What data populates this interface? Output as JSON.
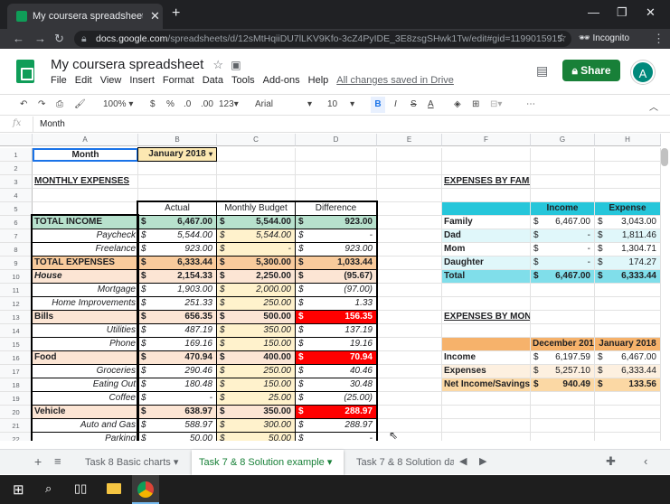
{
  "browser": {
    "tab_title": "My coursera spreadsheet - Goog",
    "url_domain": "docs.google.com",
    "url_path": "/spreadsheets/d/12sMtHqiiDU7lLKV9Kfo-3cZ4PyIDE_3E8zsgSHwk1Tw/edit#gid=1199015915",
    "incognito_label": "Incognito"
  },
  "doc": {
    "title": "My coursera spreadsheet",
    "menu": [
      "File",
      "Edit",
      "View",
      "Insert",
      "Format",
      "Data",
      "Tools",
      "Add-ons",
      "Help"
    ],
    "saved": "All changes saved in Drive",
    "share": "Share",
    "avatar": "A"
  },
  "toolbar": {
    "zoom": "100%",
    "currency": "$",
    "percent": "%",
    "dec_less": ".0",
    "dec_more": ".00",
    "fmt": "123",
    "font": "Arial",
    "size": "10",
    "bold": "B",
    "italic": "I",
    "strike": "S",
    "textcolor": "A"
  },
  "formula_bar": {
    "fx": "fx",
    "content": "Month"
  },
  "columns": [
    "A",
    "B",
    "C",
    "D",
    "E",
    "F",
    "G",
    "H"
  ],
  "rows": [
    "1",
    "2",
    "3",
    "4",
    "5",
    "6",
    "7",
    "8",
    "9",
    "10",
    "11",
    "12",
    "13",
    "14",
    "15",
    "16",
    "17",
    "18",
    "19",
    "20",
    "21",
    "22"
  ],
  "cells": [
    {
      "k": "A1",
      "r": 1,
      "c": "A",
      "t": "Month",
      "al": "c",
      "b": 1,
      "bd": "#1a73e8"
    },
    {
      "k": "B1",
      "r": 1,
      "c": "B",
      "t": "January 2018",
      "al": "c",
      "b": 1,
      "bg": "#fce8b2",
      "dd": 1
    },
    {
      "k": "A3",
      "r": 3,
      "c": "A",
      "t": "MONTHLY EXPENSES",
      "b": 1,
      "u": 1
    },
    {
      "k": "B5",
      "r": 5,
      "c": "B",
      "t": "Actual",
      "al": "c"
    },
    {
      "k": "C5",
      "r": 5,
      "c": "C",
      "t": "Monthly Budget",
      "al": "c"
    },
    {
      "k": "D5",
      "r": 5,
      "c": "D",
      "t": "Difference",
      "al": "c"
    },
    {
      "k": "A6",
      "r": 6,
      "c": "A",
      "t": "TOTAL INCOME",
      "b": 1,
      "bg": "#b7e1cd"
    },
    {
      "k": "B6",
      "r": 6,
      "c": "B",
      "t": "6,467.00",
      "b": 1,
      "bg": "#b7e1cd",
      "cur": 1
    },
    {
      "k": "C6",
      "r": 6,
      "c": "C",
      "t": "5,544.00",
      "b": 1,
      "bg": "#b7e1cd",
      "cur": 1
    },
    {
      "k": "D6",
      "r": 6,
      "c": "D",
      "t": "923.00",
      "b": 1,
      "bg": "#b7e1cd",
      "cur": 1
    },
    {
      "k": "A7",
      "r": 7,
      "c": "A",
      "t": "Paycheck",
      "i": 1,
      "al": "r"
    },
    {
      "k": "B7",
      "r": 7,
      "c": "B",
      "t": "5,544.00",
      "i": 1,
      "cur": 1
    },
    {
      "k": "C7",
      "r": 7,
      "c": "C",
      "t": "5,544.00",
      "i": 1,
      "bg": "#fff2cc",
      "cur": 1
    },
    {
      "k": "D7",
      "r": 7,
      "c": "D",
      "t": "-",
      "i": 1,
      "cur": 1
    },
    {
      "k": "A8",
      "r": 8,
      "c": "A",
      "t": "Freelance",
      "i": 1,
      "al": "r"
    },
    {
      "k": "B8",
      "r": 8,
      "c": "B",
      "t": "923.00",
      "i": 1,
      "cur": 1
    },
    {
      "k": "C8",
      "r": 8,
      "c": "C",
      "t": "-",
      "i": 1,
      "bg": "#fff2cc",
      "cur": 1
    },
    {
      "k": "D8",
      "r": 8,
      "c": "D",
      "t": "923.00",
      "i": 1,
      "cur": 1
    },
    {
      "k": "A9",
      "r": 9,
      "c": "A",
      "t": "TOTAL EXPENSES",
      "b": 1,
      "bg": "#f9cb9c"
    },
    {
      "k": "B9",
      "r": 9,
      "c": "B",
      "t": "6,333.44",
      "b": 1,
      "bg": "#f9cb9c",
      "cur": 1
    },
    {
      "k": "C9",
      "r": 9,
      "c": "C",
      "t": "5,300.00",
      "b": 1,
      "bg": "#f9cb9c",
      "cur": 1
    },
    {
      "k": "D9",
      "r": 9,
      "c": "D",
      "t": "1,033.44",
      "b": 1,
      "bg": "#f9cb9c",
      "cur": 1
    },
    {
      "k": "A10",
      "r": 10,
      "c": "A",
      "t": "House",
      "b": 1,
      "i": 1,
      "bg": "#fce5d4"
    },
    {
      "k": "B10",
      "r": 10,
      "c": "B",
      "t": "2,154.33",
      "b": 1,
      "bg": "#fce5d4",
      "cur": 1
    },
    {
      "k": "C10",
      "r": 10,
      "c": "C",
      "t": "2,250.00",
      "b": 1,
      "bg": "#fce5d4",
      "cur": 1
    },
    {
      "k": "D10",
      "r": 10,
      "c": "D",
      "t": "(95.67)",
      "b": 1,
      "bg": "#fce5d4",
      "cur": 1
    },
    {
      "k": "A11",
      "r": 11,
      "c": "A",
      "t": "Mortgage",
      "i": 1,
      "al": "r"
    },
    {
      "k": "B11",
      "r": 11,
      "c": "B",
      "t": "1,903.00",
      "i": 1,
      "cur": 1
    },
    {
      "k": "C11",
      "r": 11,
      "c": "C",
      "t": "2,000.00",
      "i": 1,
      "bg": "#fff2cc",
      "cur": 1
    },
    {
      "k": "D11",
      "r": 11,
      "c": "D",
      "t": "(97.00)",
      "i": 1,
      "cur": 1
    },
    {
      "k": "A12",
      "r": 12,
      "c": "A",
      "t": "Home Improvements",
      "i": 1,
      "al": "r"
    },
    {
      "k": "B12",
      "r": 12,
      "c": "B",
      "t": "251.33",
      "i": 1,
      "cur": 1
    },
    {
      "k": "C12",
      "r": 12,
      "c": "C",
      "t": "250.00",
      "i": 1,
      "bg": "#fff2cc",
      "cur": 1
    },
    {
      "k": "D12",
      "r": 12,
      "c": "D",
      "t": "1.33",
      "i": 1,
      "cur": 1
    },
    {
      "k": "A13",
      "r": 13,
      "c": "A",
      "t": "Bills",
      "b": 1,
      "bg": "#fce5d4"
    },
    {
      "k": "B13",
      "r": 13,
      "c": "B",
      "t": "656.35",
      "b": 1,
      "bg": "#fce5d4",
      "cur": 1
    },
    {
      "k": "C13",
      "r": 13,
      "c": "C",
      "t": "500.00",
      "b": 1,
      "bg": "#fce5d4",
      "cur": 1
    },
    {
      "k": "D13",
      "r": 13,
      "c": "D",
      "t": "156.35",
      "b": 1,
      "bg": "#ff0000",
      "fg": "#fff",
      "cur": 1
    },
    {
      "k": "A14",
      "r": 14,
      "c": "A",
      "t": "Utilities",
      "i": 1,
      "al": "r"
    },
    {
      "k": "B14",
      "r": 14,
      "c": "B",
      "t": "487.19",
      "i": 1,
      "cur": 1
    },
    {
      "k": "C14",
      "r": 14,
      "c": "C",
      "t": "350.00",
      "i": 1,
      "bg": "#fff2cc",
      "cur": 1
    },
    {
      "k": "D14",
      "r": 14,
      "c": "D",
      "t": "137.19",
      "i": 1,
      "cur": 1
    },
    {
      "k": "A15",
      "r": 15,
      "c": "A",
      "t": "Phone",
      "i": 1,
      "al": "r"
    },
    {
      "k": "B15",
      "r": 15,
      "c": "B",
      "t": "169.16",
      "i": 1,
      "cur": 1
    },
    {
      "k": "C15",
      "r": 15,
      "c": "C",
      "t": "150.00",
      "i": 1,
      "bg": "#fff2cc",
      "cur": 1
    },
    {
      "k": "D15",
      "r": 15,
      "c": "D",
      "t": "19.16",
      "i": 1,
      "cur": 1
    },
    {
      "k": "A16",
      "r": 16,
      "c": "A",
      "t": "Food",
      "b": 1,
      "bg": "#fce5d4"
    },
    {
      "k": "B16",
      "r": 16,
      "c": "B",
      "t": "470.94",
      "b": 1,
      "bg": "#fce5d4",
      "cur": 1
    },
    {
      "k": "C16",
      "r": 16,
      "c": "C",
      "t": "400.00",
      "b": 1,
      "bg": "#fce5d4",
      "cur": 1
    },
    {
      "k": "D16",
      "r": 16,
      "c": "D",
      "t": "70.94",
      "b": 1,
      "bg": "#ff0000",
      "fg": "#fff",
      "cur": 1
    },
    {
      "k": "A17",
      "r": 17,
      "c": "A",
      "t": "Groceries",
      "i": 1,
      "al": "r"
    },
    {
      "k": "B17",
      "r": 17,
      "c": "B",
      "t": "290.46",
      "i": 1,
      "cur": 1
    },
    {
      "k": "C17",
      "r": 17,
      "c": "C",
      "t": "250.00",
      "i": 1,
      "bg": "#fff2cc",
      "cur": 1
    },
    {
      "k": "D17",
      "r": 17,
      "c": "D",
      "t": "40.46",
      "i": 1,
      "cur": 1
    },
    {
      "k": "A18",
      "r": 18,
      "c": "A",
      "t": "Eating Out",
      "i": 1,
      "al": "r"
    },
    {
      "k": "B18",
      "r": 18,
      "c": "B",
      "t": "180.48",
      "i": 1,
      "cur": 1
    },
    {
      "k": "C18",
      "r": 18,
      "c": "C",
      "t": "150.00",
      "i": 1,
      "bg": "#fff2cc",
      "cur": 1
    },
    {
      "k": "D18",
      "r": 18,
      "c": "D",
      "t": "30.48",
      "i": 1,
      "cur": 1
    },
    {
      "k": "A19",
      "r": 19,
      "c": "A",
      "t": "Coffee",
      "i": 1,
      "al": "r"
    },
    {
      "k": "B19",
      "r": 19,
      "c": "B",
      "t": "-",
      "i": 1,
      "cur": 1
    },
    {
      "k": "C19",
      "r": 19,
      "c": "C",
      "t": "25.00",
      "i": 1,
      "bg": "#fff2cc",
      "cur": 1
    },
    {
      "k": "D19",
      "r": 19,
      "c": "D",
      "t": "(25.00)",
      "i": 1,
      "cur": 1
    },
    {
      "k": "A20",
      "r": 20,
      "c": "A",
      "t": "Vehicle",
      "b": 1,
      "bg": "#fce5d4"
    },
    {
      "k": "B20",
      "r": 20,
      "c": "B",
      "t": "638.97",
      "b": 1,
      "bg": "#fce5d4",
      "cur": 1
    },
    {
      "k": "C20",
      "r": 20,
      "c": "C",
      "t": "350.00",
      "b": 1,
      "bg": "#fce5d4",
      "cur": 1
    },
    {
      "k": "D20",
      "r": 20,
      "c": "D",
      "t": "288.97",
      "b": 1,
      "bg": "#ff0000",
      "fg": "#fff",
      "cur": 1
    },
    {
      "k": "A21",
      "r": 21,
      "c": "A",
      "t": "Auto and Gas",
      "i": 1,
      "al": "r"
    },
    {
      "k": "B21",
      "r": 21,
      "c": "B",
      "t": "588.97",
      "i": 1,
      "cur": 1
    },
    {
      "k": "C21",
      "r": 21,
      "c": "C",
      "t": "300.00",
      "i": 1,
      "bg": "#fff2cc",
      "cur": 1
    },
    {
      "k": "D21",
      "r": 21,
      "c": "D",
      "t": "288.97",
      "i": 1,
      "cur": 1
    },
    {
      "k": "A22",
      "r": 22,
      "c": "A",
      "t": "Parking",
      "i": 1,
      "al": "r"
    },
    {
      "k": "B22",
      "r": 22,
      "c": "B",
      "t": "50.00",
      "i": 1,
      "cur": 1
    },
    {
      "k": "C22",
      "r": 22,
      "c": "C",
      "t": "50.00",
      "i": 1,
      "bg": "#fff2cc",
      "cur": 1
    },
    {
      "k": "D22",
      "r": 22,
      "c": "D",
      "t": "-",
      "i": 1,
      "cur": 1
    },
    {
      "k": "F3",
      "r": 3,
      "c": "F",
      "t": "EXPENSES BY FAMILY MEMBER",
      "b": 1,
      "u": 1
    },
    {
      "k": "F5",
      "r": 5,
      "c": "F",
      "t": "",
      "bg": "#26c6da"
    },
    {
      "k": "G5",
      "r": 5,
      "c": "G",
      "t": "Income",
      "b": 1,
      "al": "c",
      "bg": "#26c6da"
    },
    {
      "k": "H5",
      "r": 5,
      "c": "H",
      "t": "Expense",
      "b": 1,
      "al": "c",
      "bg": "#26c6da"
    },
    {
      "k": "F6",
      "r": 6,
      "c": "F",
      "t": "Family",
      "b": 1
    },
    {
      "k": "G6",
      "r": 6,
      "c": "G",
      "t": "6,467.00",
      "cur": 1
    },
    {
      "k": "H6",
      "r": 6,
      "c": "H",
      "t": "3,043.00",
      "cur": 1
    },
    {
      "k": "F7",
      "r": 7,
      "c": "F",
      "t": "Dad",
      "b": 1,
      "bg": "#e0f7fa"
    },
    {
      "k": "G7",
      "r": 7,
      "c": "G",
      "t": "-",
      "bg": "#e0f7fa",
      "cur": 1
    },
    {
      "k": "H7",
      "r": 7,
      "c": "H",
      "t": "1,811.46",
      "bg": "#e0f7fa",
      "cur": 1
    },
    {
      "k": "F8",
      "r": 8,
      "c": "F",
      "t": "Mom",
      "b": 1
    },
    {
      "k": "G8",
      "r": 8,
      "c": "G",
      "t": "-",
      "cur": 1
    },
    {
      "k": "H8",
      "r": 8,
      "c": "H",
      "t": "1,304.71",
      "cur": 1
    },
    {
      "k": "F9",
      "r": 9,
      "c": "F",
      "t": "Daughter",
      "b": 1,
      "bg": "#e0f7fa"
    },
    {
      "k": "G9",
      "r": 9,
      "c": "G",
      "t": "-",
      "bg": "#e0f7fa",
      "cur": 1
    },
    {
      "k": "H9",
      "r": 9,
      "c": "H",
      "t": "174.27",
      "bg": "#e0f7fa",
      "cur": 1
    },
    {
      "k": "F10",
      "r": 10,
      "c": "F",
      "t": "Total",
      "b": 1,
      "bg": "#80deea"
    },
    {
      "k": "G10",
      "r": 10,
      "c": "G",
      "t": "6,467.00",
      "b": 1,
      "bg": "#80deea",
      "cur": 1
    },
    {
      "k": "H10",
      "r": 10,
      "c": "H",
      "t": "6,333.44",
      "b": 1,
      "bg": "#80deea",
      "cur": 1
    },
    {
      "k": "F13",
      "r": 13,
      "c": "F",
      "t": "EXPENSES BY MONTH",
      "b": 1,
      "u": 1
    },
    {
      "k": "F15",
      "r": 15,
      "c": "F",
      "t": "",
      "bg": "#f6b26b"
    },
    {
      "k": "G15",
      "r": 15,
      "c": "G",
      "t": "December 2017",
      "b": 1,
      "al": "c",
      "bg": "#f6b26b"
    },
    {
      "k": "H15",
      "r": 15,
      "c": "H",
      "t": "January 2018",
      "b": 1,
      "al": "c",
      "bg": "#f6b26b"
    },
    {
      "k": "F16",
      "r": 16,
      "c": "F",
      "t": "Income",
      "b": 1
    },
    {
      "k": "G16",
      "r": 16,
      "c": "G",
      "t": "6,197.59",
      "cur": 1
    },
    {
      "k": "H16",
      "r": 16,
      "c": "H",
      "t": "6,467.00",
      "cur": 1
    },
    {
      "k": "F17",
      "r": 17,
      "c": "F",
      "t": "Expenses",
      "b": 1,
      "bg": "#fdf0e0"
    },
    {
      "k": "G17",
      "r": 17,
      "c": "G",
      "t": "5,257.10",
      "bg": "#fdf0e0",
      "cur": 1
    },
    {
      "k": "H17",
      "r": 17,
      "c": "H",
      "t": "6,333.44",
      "bg": "#fdf0e0",
      "cur": 1
    },
    {
      "k": "F18",
      "r": 18,
      "c": "F",
      "t": "Net Income/Savings",
      "b": 1,
      "bg": "#fbd8a4"
    },
    {
      "k": "G18",
      "r": 18,
      "c": "G",
      "t": "940.49",
      "b": 1,
      "bg": "#fbd8a4",
      "cur": 1
    },
    {
      "k": "H18",
      "r": 18,
      "c": "H",
      "t": "133.56",
      "b": 1,
      "bg": "#fbd8a4",
      "cur": 1
    }
  ],
  "currency_symbol": "$",
  "sheet_tabs": [
    {
      "label": "Task 8 Basic charts",
      "active": false
    },
    {
      "label": "Task 7 & 8 Solution example",
      "active": true
    },
    {
      "label": "Task 7 & 8 Solution da",
      "active": false
    }
  ],
  "colors": {
    "accent": "#188038",
    "selection": "#1a73e8"
  }
}
